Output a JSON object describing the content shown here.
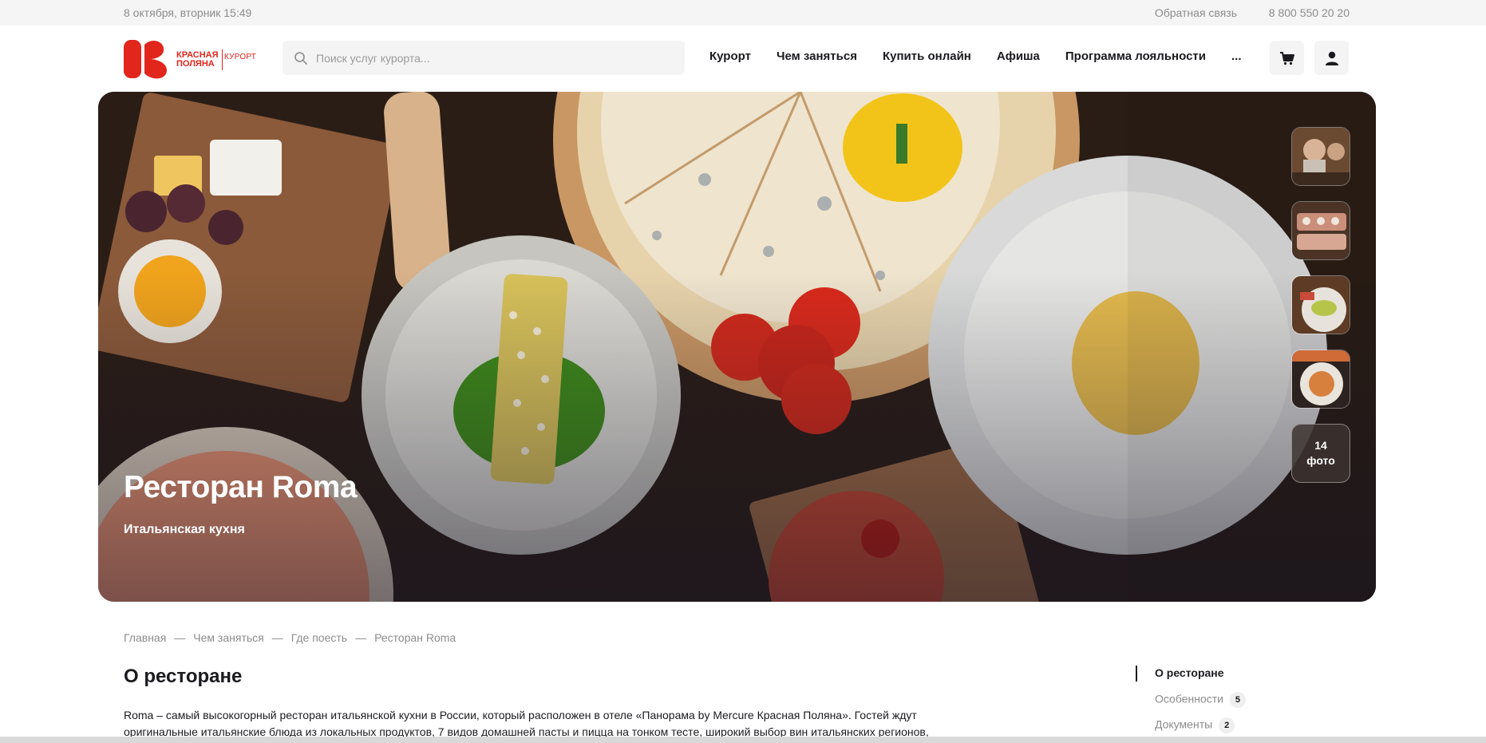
{
  "topbar": {
    "date": "8 октября, вторник 15:49",
    "feedback": "Обратная связь",
    "phone": "8 800 550 20 20"
  },
  "header": {
    "logo": {
      "line1": "Красная",
      "line2": "Поляна",
      "sub": "Курорт"
    },
    "search_placeholder": "Поиск услуг курорта...",
    "nav": [
      "Курорт",
      "Чем заняться",
      "Купить онлайн",
      "Афиша",
      "Программа лояльности",
      "..."
    ]
  },
  "hero": {
    "title": "Ресторан Roma",
    "subtitle": "Итальянская кухня",
    "photo_count": "14",
    "photo_label": "фото"
  },
  "breadcrumb": [
    "Главная",
    "Чем заняться",
    "Где поесть",
    "Ресторан Roma"
  ],
  "breadcrumb_separator": "—",
  "main": {
    "section_title": "О ресторане",
    "about_text": "Roma – самый высокогорный ресторан итальянской кухни в России, который расположен в отеле «Панорама by Mercure Красная Поляна». Гостей ждут оригинальные итальянские блюда из локальных продуктов, 7 видов домашней пасты и пицца на тонком тесте, широкий выбор вин итальянских регионов,"
  },
  "side_nav": {
    "items": [
      {
        "label": "О ресторане"
      },
      {
        "label": "Особенности",
        "count": "5"
      },
      {
        "label": "Документы",
        "count": "2"
      }
    ]
  },
  "colors": {
    "brand_red": "#e1261c",
    "text": "#1b1b1f",
    "muted": "#8c8c8c",
    "field_bg": "#f4f4f4"
  },
  "icons": [
    "search-icon",
    "cart-icon",
    "user-icon",
    "logo-k-icon"
  ]
}
